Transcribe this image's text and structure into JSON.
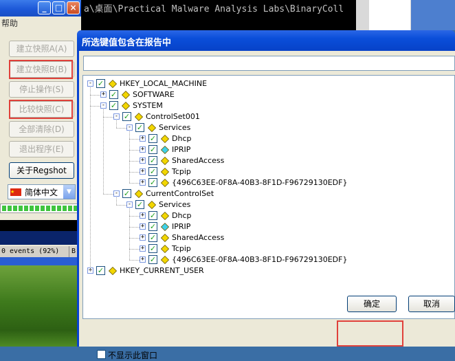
{
  "terminal": {
    "text": "a\\桌面\\Practical Malware Analysis Labs\\BinaryColl"
  },
  "bg_window": {
    "menu": "帮助",
    "buttons": [
      {
        "label": "建立快照A(A)",
        "enabled": false
      },
      {
        "label": "建立快照B(B)",
        "enabled": false
      },
      {
        "label": "停止操作(S)",
        "enabled": false
      },
      {
        "label": "比较快照(C)",
        "enabled": false
      },
      {
        "label": "全部清除(D)",
        "enabled": false
      },
      {
        "label": "退出程序(E)",
        "enabled": false
      },
      {
        "label": "关于Regshot",
        "enabled": true
      }
    ],
    "language": "简体中文",
    "events": "0 events (92%)",
    "status_b": "B"
  },
  "dialog": {
    "title": "所选键值包含在报告中",
    "search_value": "",
    "tree": [
      {
        "label": "HKEY_LOCAL_MACHINE",
        "level": 0,
        "expander": "−",
        "checked": true,
        "icon": "folder-key-icon"
      },
      {
        "label": "SOFTWARE",
        "level": 1,
        "expander": "+",
        "checked": true,
        "icon": "folder-key-icon"
      },
      {
        "label": "SYSTEM",
        "level": 1,
        "expander": "−",
        "checked": true,
        "icon": "folder-key-icon"
      },
      {
        "label": "ControlSet001",
        "level": 2,
        "expander": "−",
        "checked": true,
        "icon": "folder-key-icon"
      },
      {
        "label": "Services",
        "level": 3,
        "expander": "−",
        "checked": true,
        "icon": "folder-key-icon"
      },
      {
        "label": "Dhcp",
        "level": 4,
        "expander": "+",
        "checked": true,
        "icon": "folder-key-icon"
      },
      {
        "label": "IPRIP",
        "level": 4,
        "expander": "+",
        "checked": true,
        "icon": "cyan-key-icon"
      },
      {
        "label": "SharedAccess",
        "level": 4,
        "expander": "+",
        "checked": true,
        "icon": "folder-key-icon"
      },
      {
        "label": "Tcpip",
        "level": 4,
        "expander": "+",
        "checked": true,
        "icon": "folder-key-icon"
      },
      {
        "label": "{496C63EE-0F8A-40B3-8F1D-F96729130EDF}",
        "level": 4,
        "expander": "+",
        "checked": true,
        "icon": "folder-key-icon"
      },
      {
        "label": "CurrentControlSet",
        "level": 2,
        "expander": "−",
        "checked": true,
        "icon": "folder-key-icon"
      },
      {
        "label": "Services",
        "level": 3,
        "expander": "−",
        "checked": true,
        "icon": "folder-key-icon"
      },
      {
        "label": "Dhcp",
        "level": 4,
        "expander": "+",
        "checked": true,
        "icon": "folder-key-icon"
      },
      {
        "label": "IPRIP",
        "level": 4,
        "expander": "+",
        "checked": true,
        "icon": "cyan-key-icon"
      },
      {
        "label": "SharedAccess",
        "level": 4,
        "expander": "+",
        "checked": true,
        "icon": "folder-key-icon"
      },
      {
        "label": "Tcpip",
        "level": 4,
        "expander": "+",
        "checked": true,
        "icon": "folder-key-icon"
      },
      {
        "label": "{496C63EE-0F8A-40B3-8F1D-F96729130EDF}",
        "level": 4,
        "expander": "+",
        "checked": true,
        "icon": "folder-key-icon"
      },
      {
        "label": "HKEY_CURRENT_USER",
        "level": 0,
        "expander": "+",
        "checked": true,
        "icon": "folder-key-icon"
      }
    ],
    "no_show_label": "不显示此窗口",
    "ok_label": "确定",
    "cancel_label": "取消"
  },
  "colors": {
    "highlight_box": "#e0403a",
    "dialog_title": "#0a4ed9",
    "key_yellow": "#f2d600",
    "key_cyan": "#3fd0e8"
  }
}
